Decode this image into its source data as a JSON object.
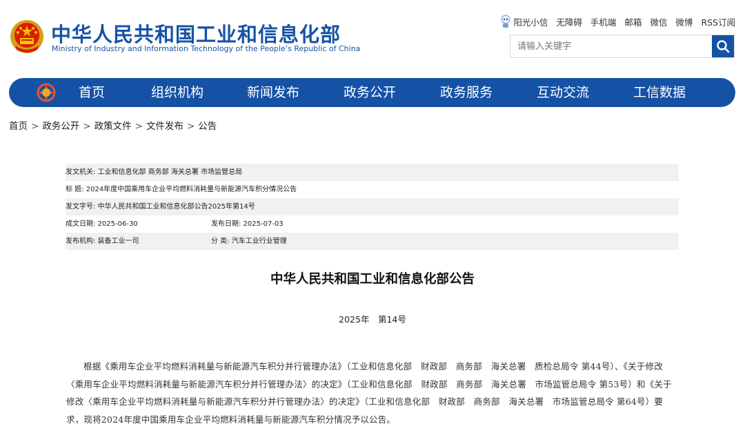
{
  "header": {
    "title_cn": "中华人民共和国工业和信息化部",
    "title_en": "Ministry of Industry and Information Technology of the People’s Republic of China",
    "toplinks": [
      "阳光小信",
      "无障碍",
      "手机端",
      "邮箱",
      "微信",
      "微博",
      "RSS订阅"
    ],
    "search_placeholder": "请输入关键字"
  },
  "nav": {
    "items": [
      "首页",
      "组织机构",
      "新闻发布",
      "政务公开",
      "政务服务",
      "互动交流",
      "工信数据"
    ]
  },
  "breadcrumb": [
    "首页",
    "政务公开",
    "政策文件",
    "文件发布",
    "公告"
  ],
  "breadcrumb_separator": ">",
  "meta": {
    "issuer": "发文机关:  工业和信息化部 商务部 海关总署 市场监管总局",
    "title": "标       题:  2024年度中国乘用车企业平均燃料消耗量与新能源汽车积分情况公告",
    "doc_no": "发文字号:  中华人民共和国工业和信息化部公告2025年第14号",
    "written_date": "成文日期:  2025-06-30",
    "publish_date": "发布日期:  2025-07-03",
    "publisher": "发布机构:  装备工业一司",
    "category": "分       类:  汽车工业行业管理"
  },
  "document": {
    "title": "中华人民共和国工业和信息化部公告",
    "number": "2025年　第14号",
    "paragraph": "根据《乘用车企业平均燃料消耗量与新能源汽车积分并行管理办法》（工业和信息化部　财政部　商务部　海关总署　质检总局令 第44号）、《关于修改〈乘用车企业平均燃料消耗量与新能源汽车积分并行管理办法〉的决定》（工业和信息化部　财政部　商务部　海关总署　市场监管总局令 第53号）和《关于修改〈乘用车企业平均燃料消耗量与新能源汽车积分并行管理办法〉的决定》（工业和信息化部　财政部　商务部　海关总署　市场监管总局令 第64号）要求，现将2024年度中国乘用车企业平均燃料消耗量与新能源汽车积分情况予以公告。"
  },
  "colors": {
    "brand_blue": "#1552a6",
    "meta_shade": "#f1f1f1"
  },
  "icons": [
    "national-emblem-icon",
    "robot-mascot-icon",
    "search-icon",
    "nav-logo-icon"
  ]
}
